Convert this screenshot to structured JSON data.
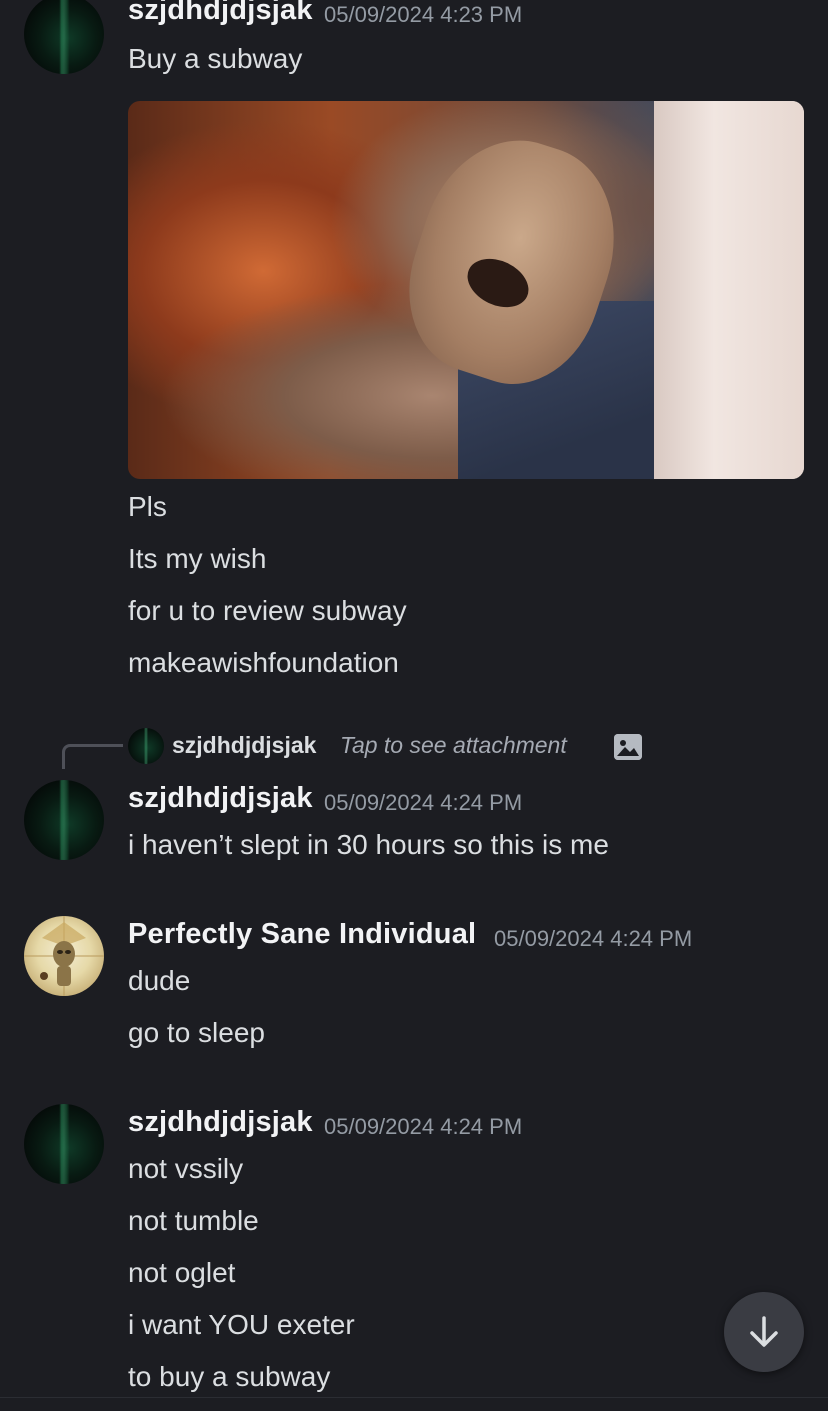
{
  "messages": [
    {
      "author": "szjdhdjdjsjak",
      "timestamp": "05/09/2024 4:23 PM",
      "lines": [
        "Buy a subway"
      ],
      "after_attachment": [
        "Pls",
        "Its my wish",
        "for u to review subway",
        "makeawishfoundation"
      ]
    },
    {
      "reply": {
        "author": "szjdhdjdjsjak",
        "text": "Tap to see attachment",
        "icon": "image-icon"
      },
      "author": "szjdhdjdjsjak",
      "timestamp": "05/09/2024 4:24 PM",
      "lines": [
        "i haven’t slept in 30 hours so this is me"
      ]
    },
    {
      "author": "Perfectly Sane Individual",
      "timestamp": "05/09/2024 4:24 PM",
      "lines": [
        "dude",
        "go to sleep"
      ]
    },
    {
      "author": "szjdhdjdjsjak",
      "timestamp": "05/09/2024 4:24 PM",
      "lines": [
        "not vssily",
        "not tumble",
        "not oglet",
        "i want YOU exeter",
        "to buy a subway"
      ]
    }
  ],
  "scroll_button_icon": "arrow-down-icon",
  "colors": {
    "background": "#1c1d22",
    "username": "#f2f3f5",
    "timestamp": "#949ba4",
    "text": "#dbdee1"
  }
}
